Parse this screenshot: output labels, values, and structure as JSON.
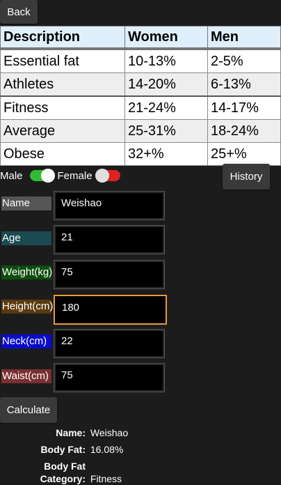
{
  "back_label": "Back",
  "table": {
    "headers": [
      "Description",
      "Women",
      "Men"
    ],
    "rows": [
      [
        "Essential fat",
        "10-13%",
        "2-5%"
      ],
      [
        "Athletes",
        "14-20%",
        "6-13%"
      ],
      [
        "Fitness",
        "21-24%",
        "14-17%"
      ],
      [
        "Average",
        "25-31%",
        "18-24%"
      ],
      [
        "Obese",
        "32+%",
        "25+%"
      ]
    ]
  },
  "gender": {
    "male_label": "Male",
    "female_label": "Female",
    "male_on": true,
    "female_on": false
  },
  "history_label": "History",
  "form": {
    "name_label": "Name",
    "name_value": "Weishao",
    "age_label": "Age",
    "age_value": "21",
    "weight_label": "Weight(kg)",
    "weight_value": "75",
    "height_label": "Height(cm)",
    "height_value": "180",
    "neck_label": "Neck(cm)",
    "neck_value": "22",
    "waist_label": "Waist(cm)",
    "waist_value": "75"
  },
  "colors": {
    "name_label_bg": "#555555",
    "age_label_bg": "#1a4a52",
    "weight_label_bg": "#0f4d0f",
    "height_label_bg": "#5a3a10",
    "neck_label_bg": "#0a0acc",
    "waist_label_bg": "#7a3030",
    "focus_border": "#e89a3c"
  },
  "calculate_label": "Calculate",
  "results": {
    "name_key": "Name:",
    "name_val": "Weishao",
    "fat_key": "Body Fat:",
    "fat_val": "16.08%",
    "cat_key": "Body Fat Category:",
    "cat_val": "Fitness"
  }
}
